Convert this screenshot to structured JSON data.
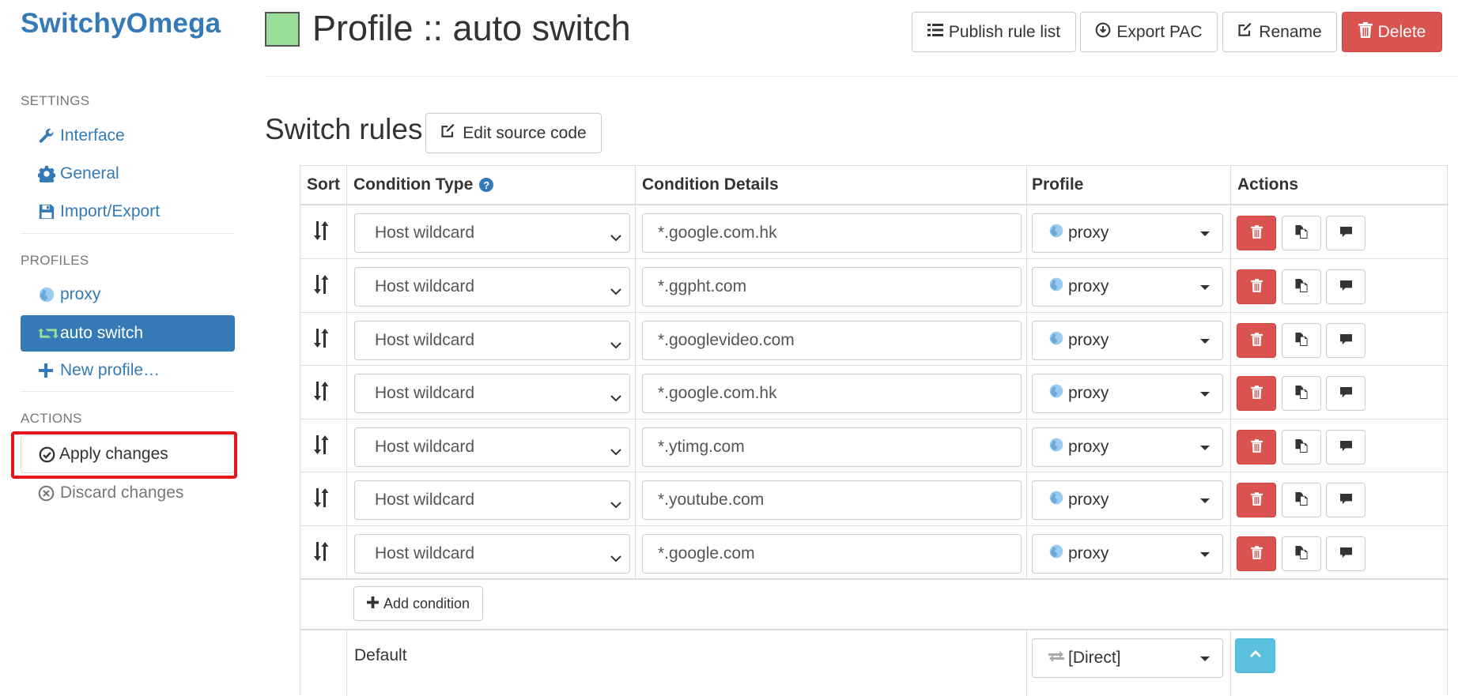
{
  "app": {
    "title": "SwitchyOmega"
  },
  "sidebar": {
    "settings_header": "SETTINGS",
    "settings_items": [
      {
        "label": "Interface",
        "icon": "wrench-icon"
      },
      {
        "label": "General",
        "icon": "gear-icon"
      },
      {
        "label": "Import/Export",
        "icon": "floppy-disk-icon"
      }
    ],
    "profiles_header": "PROFILES",
    "profiles": [
      {
        "label": "proxy",
        "icon": "globe-icon"
      },
      {
        "label": "auto switch",
        "icon": "retweet-icon",
        "active": true
      },
      {
        "label": "New profile…",
        "icon": "plus-icon"
      }
    ],
    "actions_header": "ACTIONS",
    "actions": [
      {
        "label": "Apply changes",
        "icon": "check-circle-icon"
      },
      {
        "label": "Discard changes",
        "icon": "x-circle-icon"
      }
    ]
  },
  "header": {
    "title": "Profile :: auto switch",
    "color": "#99dd99",
    "buttons": {
      "publish": "Publish rule list",
      "export": "Export PAC",
      "rename": "Rename",
      "delete": "Delete"
    }
  },
  "rules": {
    "section_title": "Switch rules",
    "edit_source": "Edit source code",
    "columns": {
      "sort": "Sort",
      "condition_type": "Condition Type",
      "condition_details": "Condition Details",
      "profile": "Profile",
      "actions": "Actions"
    },
    "items": [
      {
        "type": "Host wildcard",
        "details": "*.google.com.hk",
        "profile": "proxy"
      },
      {
        "type": "Host wildcard",
        "details": "*.ggpht.com",
        "profile": "proxy"
      },
      {
        "type": "Host wildcard",
        "details": "*.googlevideo.com",
        "profile": "proxy"
      },
      {
        "type": "Host wildcard",
        "details": "*.google.com.hk",
        "profile": "proxy"
      },
      {
        "type": "Host wildcard",
        "details": "*.ytimg.com",
        "profile": "proxy"
      },
      {
        "type": "Host wildcard",
        "details": "*.youtube.com",
        "profile": "proxy"
      },
      {
        "type": "Host wildcard",
        "details": "*.google.com",
        "profile": "proxy"
      }
    ],
    "add_condition": "Add condition",
    "default": {
      "label": "Default",
      "profile": "[Direct]"
    }
  },
  "colors": {
    "accent": "#337ab7",
    "danger": "#d9534f",
    "info": "#5bc0de",
    "highlight": "#e8141b"
  }
}
